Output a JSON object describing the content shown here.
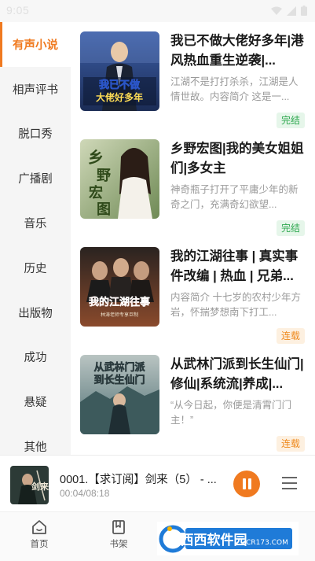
{
  "status_bar": {
    "time": "9:05"
  },
  "sidebar": {
    "items": [
      {
        "label": "有声小说",
        "active": true
      },
      {
        "label": "相声评书"
      },
      {
        "label": "脱口秀"
      },
      {
        "label": "广播剧"
      },
      {
        "label": "音乐"
      },
      {
        "label": "历史"
      },
      {
        "label": "出版物"
      },
      {
        "label": "成功"
      },
      {
        "label": "悬疑"
      },
      {
        "label": "其他"
      }
    ]
  },
  "books": [
    {
      "title": "我已不做大佬好多年|港风热血重生逆袭|...",
      "desc": "江湖不是打打杀杀，江湖是人情世故。内容简介 这是一...",
      "status": "完结",
      "status_type": "done",
      "cover_text": [
        "我已不做",
        "大佬好多年"
      ],
      "cover_colors": [
        "#1b2c55",
        "#3d5fa8"
      ]
    },
    {
      "title": "乡野宏图|我的美女姐姐们|多女主",
      "desc": "神奇瓶子打开了平庸少年的新奇之门，充满奇幻欲望...",
      "status": "完结",
      "status_type": "done",
      "cover_text": [
        "乡",
        "野",
        "宏",
        "图"
      ],
      "cover_colors": [
        "#cfd8b8",
        "#6f8a55"
      ]
    },
    {
      "title": "我的江湖往事 | 真实事件改编 | 热血 | 兄弟...",
      "desc": "内容简介 十七岁的农村少年方岩，怀揣梦想南下打工...",
      "status": "连载",
      "status_type": "serial",
      "cover_text": [
        "我的江湖往事",
        "林涛老师专享巨制"
      ],
      "cover_colors": [
        "#2a2320",
        "#8a4a2c"
      ]
    },
    {
      "title": "从武林门派到长生仙门|修仙|系统流|养成|...",
      "desc": "“从今日起，你便是清霄门门主！”",
      "status": "连载",
      "status_type": "serial",
      "cover_text": [
        "从武林门派",
        "到长生仙门"
      ],
      "cover_colors": [
        "#b9c4c2",
        "#4e6f73"
      ]
    }
  ],
  "player": {
    "title": "0001.【求订阅】剑来（5） - ...",
    "time": "00:04/08:18",
    "cover_text": "剑来"
  },
  "bottom_nav": {
    "items": [
      {
        "label": "首页",
        "icon": "home-icon"
      },
      {
        "label": "书架",
        "icon": "bookshelf-icon"
      }
    ]
  },
  "watermark": {
    "text": "西西软件园",
    "sub": "CR173.COM"
  },
  "colors": {
    "accent": "#f07a20",
    "done_green": "#2ea84f",
    "serial_orange": "#ef8a1e"
  }
}
